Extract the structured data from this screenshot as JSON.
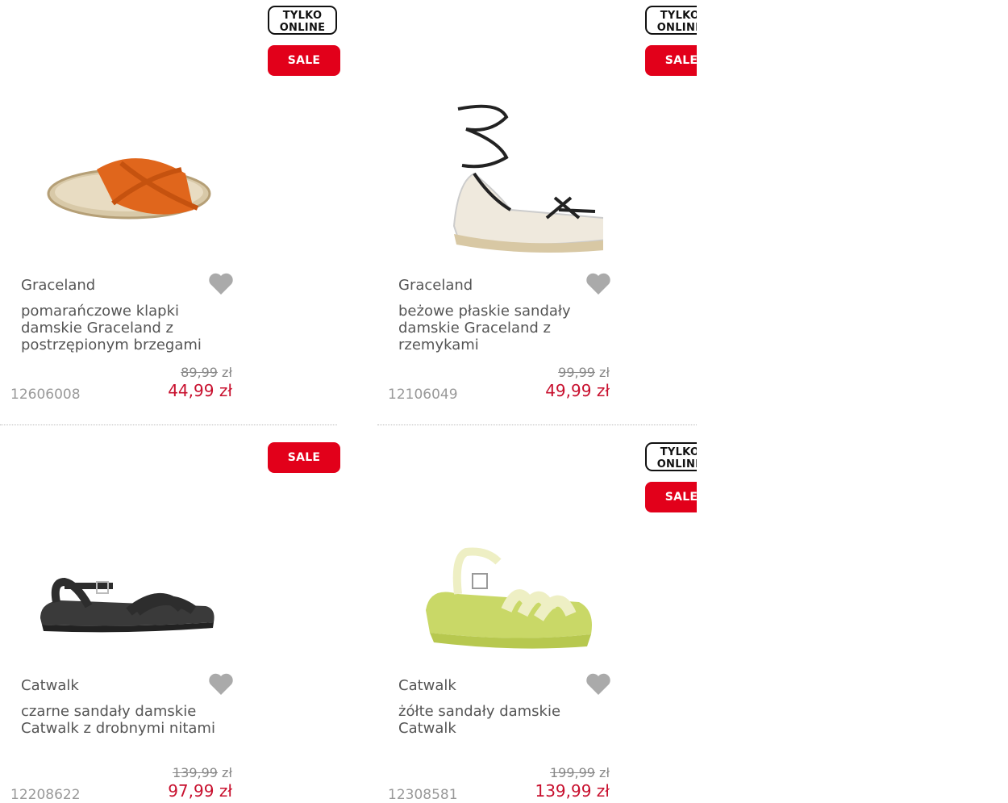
{
  "badges": {
    "online_line1": "TYLKO",
    "online_line2": "ONLINE",
    "sale": "SALE"
  },
  "currency": "zł",
  "colors": {
    "sale_red": "#e2001a",
    "price_red": "#c8102e"
  },
  "products": [
    {
      "brand": "Graceland",
      "title": "pomarańczowe klapki damskie Graceland z postrzępionym brzegami",
      "old_price": "89,99",
      "new_price": "44,99 zł",
      "sku": "12606008",
      "online_only": true,
      "sale": true
    },
    {
      "brand": "Graceland",
      "title": "beżowe płaskie sandały damskie Graceland z rzemykami",
      "old_price": "99,99",
      "new_price": "49,99 zł",
      "sku": "12106049",
      "online_only": true,
      "sale": true
    },
    {
      "brand": "Catwalk",
      "title": "czarne sandały damskie Catwalk z drobnymi nitami",
      "old_price": "139,99",
      "new_price": "97,99 zł",
      "sku": "12208622",
      "online_only": false,
      "sale": true
    },
    {
      "brand": "Catwalk",
      "title": "żółte sandały damskie Catwalk",
      "old_price": "199,99",
      "new_price": "139,99 zł",
      "sku": "12308581",
      "online_only": true,
      "sale": true
    }
  ]
}
